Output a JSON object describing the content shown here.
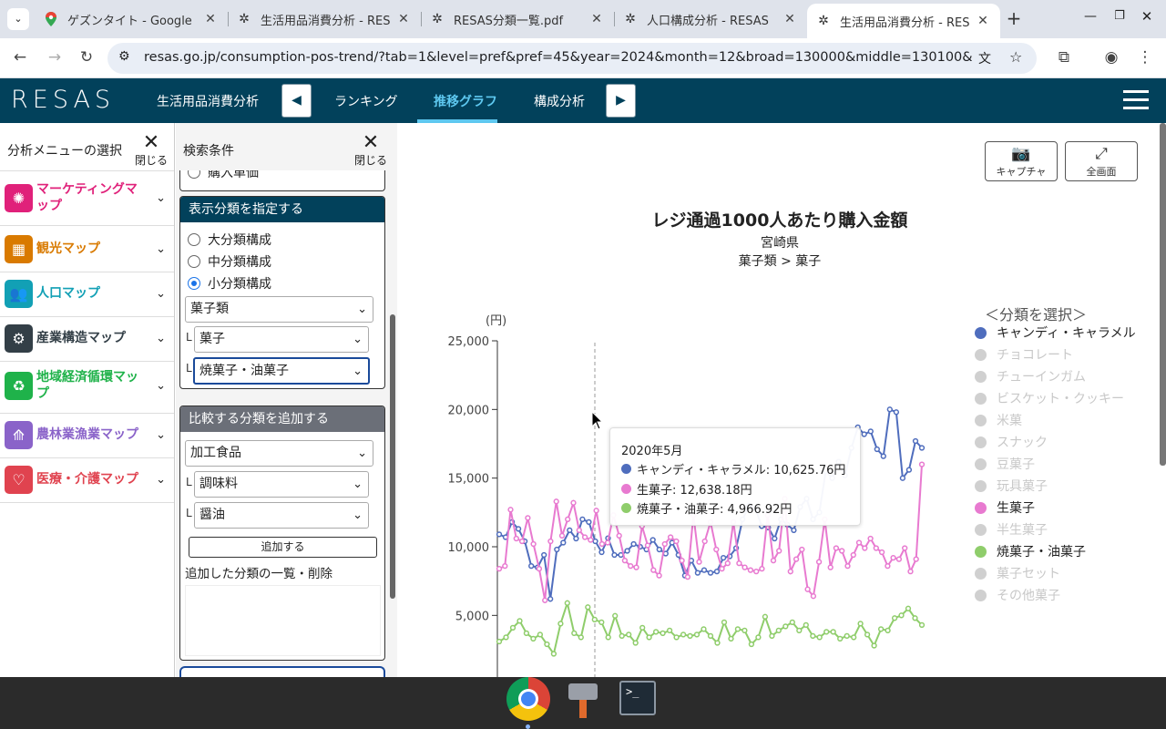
{
  "browser": {
    "tabs": [
      {
        "title": "ゲズンタイト - Google",
        "icon": "maps-icon"
      },
      {
        "title": "生活用品消費分析 - RES",
        "icon": "resas-icon"
      },
      {
        "title": "RESAS分類一覧.pdf",
        "icon": "resas-icon"
      },
      {
        "title": "人口構成分析 - RESAS",
        "icon": "resas-icon"
      },
      {
        "title": "生活用品消費分析 - RES",
        "icon": "resas-icon",
        "active": true
      }
    ],
    "url": "resas.go.jp/consumption-pos-trend/?tab=1&level=pref&pref=45&year=2024&month=12&broad=130000&middle=130100&..."
  },
  "site": {
    "logo": "RESAS",
    "nav_section": "生活用品消費分析",
    "nav_tabs": [
      "ランキング",
      "推移グラフ",
      "構成分析"
    ],
    "active_tab": "推移グラフ"
  },
  "leftmenu": {
    "title": "分析メニューの選択",
    "close_label": "閉じる",
    "items": [
      {
        "label": "マーケティングマップ",
        "color": "#e0217a",
        "icon": "lightbulb-icon"
      },
      {
        "label": "観光マップ",
        "color": "#d97a00",
        "icon": "map-icon"
      },
      {
        "label": "人口マップ",
        "color": "#12a0b5",
        "icon": "people-icon"
      },
      {
        "label": "産業構造マップ",
        "color": "#333f47",
        "icon": "gears-icon"
      },
      {
        "label": "地域経済循環マップ",
        "color": "#1fb24a",
        "icon": "recycle-icon"
      },
      {
        "label": "農林業漁業マップ",
        "color": "#8a63c9",
        "icon": "plant-icon"
      },
      {
        "label": "医療・介護マップ",
        "color": "#e0434f",
        "icon": "heart-icon"
      }
    ]
  },
  "search": {
    "title": "検索条件",
    "close_label": "閉じる",
    "partial_radio": "購入単価",
    "display_box": {
      "heading": "表示分類を指定する",
      "radios": [
        "大分類構成",
        "中分類構成",
        "小分類構成"
      ],
      "selected_radio": 2,
      "select1": "菓子類",
      "select2": "菓子",
      "select3": "焼菓子・油菓子"
    },
    "compare_box": {
      "heading": "比較する分類を追加する",
      "select1": "加工食品",
      "select2": "調味料",
      "select3": "醤油",
      "add_button": "追加する",
      "list_label": "追加した分類の一覧・削除"
    }
  },
  "main": {
    "capture_label": "キャプチャ",
    "fullscreen_label": "全画面"
  },
  "tooltip": {
    "title": "2020年5月",
    "rows": [
      {
        "text": "キャンディ・キャラメル: 10,625.76円",
        "color": "#4f6dbd"
      },
      {
        "text": "生菓子: 12,638.18円",
        "color": "#e87ad0"
      },
      {
        "text": "焼菓子・油菓子: 4,966.92円",
        "color": "#8fcd6b"
      }
    ]
  },
  "legend": {
    "title": "＜分類を選択＞",
    "items": [
      {
        "label": "キャンディ・キャラメル",
        "active": true,
        "color": "#4f6dbd"
      },
      {
        "label": "チョコレート",
        "active": false,
        "color": "#d0d0d0"
      },
      {
        "label": "チューインガム",
        "active": false,
        "color": "#d0d0d0"
      },
      {
        "label": "ビスケット・クッキー",
        "active": false,
        "color": "#d0d0d0"
      },
      {
        "label": "米菓",
        "active": false,
        "color": "#d0d0d0"
      },
      {
        "label": "スナック",
        "active": false,
        "color": "#d0d0d0"
      },
      {
        "label": "豆菓子",
        "active": false,
        "color": "#d0d0d0"
      },
      {
        "label": "玩具菓子",
        "active": false,
        "color": "#d0d0d0"
      },
      {
        "label": "生菓子",
        "active": true,
        "color": "#e87ad0"
      },
      {
        "label": "半生菓子",
        "active": false,
        "color": "#d0d0d0"
      },
      {
        "label": "焼菓子・油菓子",
        "active": true,
        "color": "#8fcd6b"
      },
      {
        "label": "菓子セット",
        "active": false,
        "color": "#d0d0d0"
      },
      {
        "label": "その他菓子",
        "active": false,
        "color": "#d0d0d0"
      }
    ]
  },
  "chart_data": {
    "type": "line",
    "title": "レジ通過1000人あたり購入金額",
    "subtitle1": "宮崎県",
    "subtitle2": "菓子類 > 菓子",
    "yunit": "(円)",
    "ylim": [
      0,
      25000
    ],
    "yticks": [
      "25,000",
      "20,000",
      "15,000",
      "10,000",
      "5,000"
    ],
    "ytick_values": [
      25000,
      20000,
      15000,
      10000,
      5000
    ],
    "n_points": 64,
    "series": [
      {
        "name": "キャンディ・キャラメル",
        "color": "#4f6dbd",
        "values": [
          10900,
          10700,
          11800,
          11300,
          10400,
          8600,
          8500,
          9400,
          6200,
          9800,
          10300,
          11200,
          10600,
          12000,
          11800,
          10400,
          9600,
          10625,
          9400,
          9400,
          9700,
          10200,
          10000,
          9800,
          10500,
          9800,
          9500,
          10300,
          9400,
          7900,
          9000,
          8100,
          8300,
          8100,
          8200,
          9200,
          9300,
          9900,
          12000,
          13000,
          12800,
          11500,
          11400,
          10600,
          12000,
          11600,
          11200,
          12900,
          13500,
          12000,
          12500,
          15500,
          15000,
          16200,
          15200,
          17200,
          18700,
          18200,
          18400,
          17100,
          16600,
          20000,
          19800,
          15000,
          15600,
          17700,
          17200
        ]
      },
      {
        "name": "生菓子",
        "color": "#e87ad0",
        "values": [
          8400,
          8600,
          12700,
          10600,
          10400,
          12100,
          10200,
          8400,
          6100,
          10400,
          13300,
          10800,
          12000,
          13200,
          11200,
          10700,
          10500,
          12638,
          10200,
          10300,
          12300,
          10800,
          9000,
          8600,
          8500,
          11500,
          10100,
          8300,
          7900,
          10200,
          10700,
          10400,
          9000,
          7800,
          12300,
          8900,
          10400,
          11800,
          9800,
          8400,
          8800,
          11800,
          8800,
          8500,
          8300,
          8200,
          8400,
          12300,
          9000,
          9700,
          13500,
          8200,
          9100,
          9800,
          6900,
          6400,
          8900,
          12000,
          8500,
          9900,
          9700,
          8600,
          9400,
          10300,
          9900,
          10600,
          9900,
          9600,
          8600,
          9200,
          9100,
          9900,
          8200,
          9100,
          16000
        ]
      },
      {
        "name": "焼菓子・油菓子",
        "color": "#8fcd6b",
        "values": [
          3100,
          3400,
          4100,
          4600,
          3700,
          3300,
          3600,
          2900,
          2200,
          4400,
          5900,
          3700,
          3400,
          5600,
          4700,
          4500,
          3400,
          4967,
          3500,
          3600,
          3000,
          4100,
          3400,
          3800,
          3700,
          3900,
          3400,
          3600,
          3500,
          3600,
          4000,
          3500,
          3000,
          4500,
          3300,
          4000,
          3900,
          2900,
          3400,
          4900,
          3500,
          3900,
          4200,
          4500,
          3900,
          4300,
          3500,
          3400,
          3800,
          3800,
          3300,
          3500,
          3400,
          4400,
          3600,
          2800,
          4000,
          3900,
          4800,
          5000,
          5500,
          4800,
          4300
        ]
      }
    ]
  }
}
